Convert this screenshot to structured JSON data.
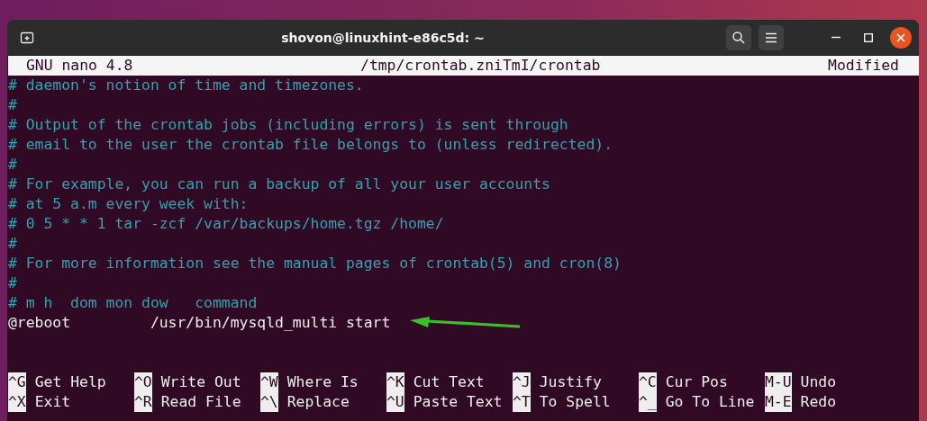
{
  "window": {
    "title": "shovon@linuxhint-e86c5d: ~"
  },
  "nano_header": {
    "version": "GNU nano 4.8",
    "file": "/tmp/crontab.zniTmI/crontab",
    "status": "Modified"
  },
  "lines": [
    {
      "kind": "comment",
      "text": "# daemon's notion of time and timezones."
    },
    {
      "kind": "comment",
      "text": "#"
    },
    {
      "kind": "comment",
      "text": "# Output of the crontab jobs (including errors) is sent through"
    },
    {
      "kind": "comment",
      "text": "# email to the user the crontab file belongs to (unless redirected)."
    },
    {
      "kind": "comment",
      "text": "#"
    },
    {
      "kind": "comment",
      "text": "# For example, you can run a backup of all your user accounts"
    },
    {
      "kind": "comment",
      "text": "# at 5 a.m every week with:"
    },
    {
      "kind": "comment",
      "text": "# 0 5 * * 1 tar -zcf /var/backups/home.tgz /home/"
    },
    {
      "kind": "comment",
      "text": "#"
    },
    {
      "kind": "comment",
      "text": "# For more information see the manual pages of crontab(5) and cron(8)"
    },
    {
      "kind": "comment",
      "text": "#"
    },
    {
      "kind": "comment",
      "text": "# m h  dom mon dow   command"
    },
    {
      "kind": "code",
      "text": "@reboot         /usr/bin/mysqld_multi start"
    }
  ],
  "shortcuts": [
    [
      {
        "key": "^G",
        "label": "Get Help"
      },
      {
        "key": "^O",
        "label": "Write Out"
      },
      {
        "key": "^W",
        "label": "Where Is"
      },
      {
        "key": "^K",
        "label": "Cut Text"
      },
      {
        "key": "^J",
        "label": "Justify"
      },
      {
        "key": "^C",
        "label": "Cur Pos"
      },
      {
        "key": "M-U",
        "label": "Undo"
      }
    ],
    [
      {
        "key": "^X",
        "label": "Exit"
      },
      {
        "key": "^R",
        "label": "Read File"
      },
      {
        "key": "^\\",
        "label": "Replace"
      },
      {
        "key": "^U",
        "label": "Paste Text"
      },
      {
        "key": "^T",
        "label": "To Spell"
      },
      {
        "key": "^_",
        "label": "Go To Line"
      },
      {
        "key": "M-E",
        "label": "Redo"
      }
    ]
  ]
}
